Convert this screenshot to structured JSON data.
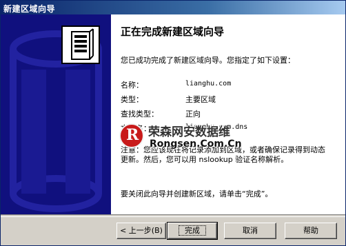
{
  "window": {
    "title": "新建区域向导"
  },
  "heading": "正在完成新建区域向导",
  "intro": "您已成功完成了新建区域向导。您指定了如下设置：",
  "settings": [
    {
      "label": "名称：",
      "value": "lianghu.com"
    },
    {
      "label": "类型：",
      "value": "主要区域"
    },
    {
      "label": "查找类型：",
      "value": "正向"
    },
    {
      "label": "文件名：",
      "value": "lianghu.com.dns"
    }
  ],
  "note": "注意：您应该现在将记录添加到区域，或者确保记录得到动态更新。然后，您可以用 nslookup 验证名称解析。",
  "closing": "要关闭此向导并创建新区域，请单击“完成”。",
  "buttons": {
    "back": "< 上一步(B)",
    "finish": "完成",
    "cancel": "取消",
    "help": "帮助"
  },
  "watermark": {
    "logo_letter": "R",
    "chinese": "荣森网安数据维",
    "english": "Rongsen.Com.Cn"
  },
  "icons": {
    "banner": "server-tower-icon",
    "watermark": "rongsen-logo-icon"
  },
  "colors": {
    "banner": "#10107e",
    "title_bar": "#0a246a"
  }
}
